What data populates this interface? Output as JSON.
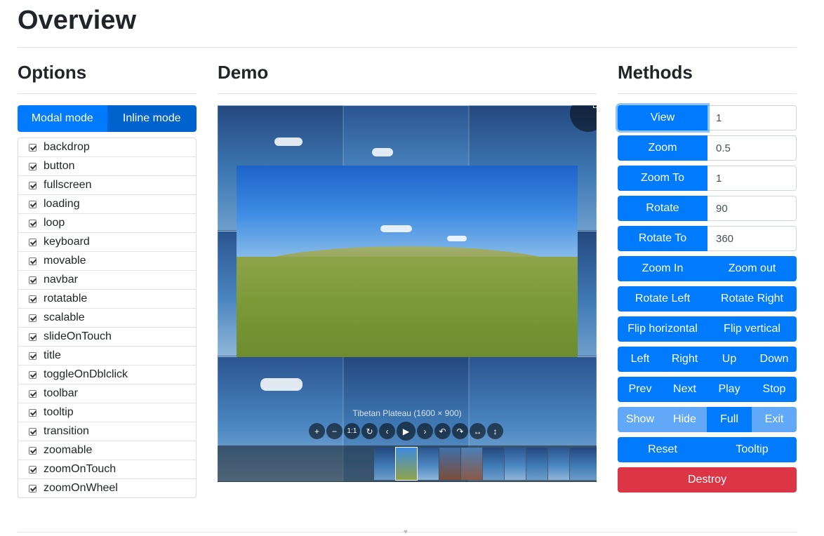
{
  "page": {
    "title": "Overview"
  },
  "columns": {
    "options": "Options",
    "demo": "Demo",
    "methods": "Methods"
  },
  "modes": {
    "modal": "Modal mode",
    "inline": "Inline mode"
  },
  "options": [
    "backdrop",
    "button",
    "fullscreen",
    "loading",
    "loop",
    "keyboard",
    "movable",
    "navbar",
    "rotatable",
    "scalable",
    "slideOnTouch",
    "title",
    "toggleOnDblclick",
    "toolbar",
    "tooltip",
    "transition",
    "zoomable",
    "zoomOnTouch",
    "zoomOnWheel"
  ],
  "viewer": {
    "caption": "Tibetan Plateau (1600 × 900)",
    "toolbar": [
      "+",
      "−",
      "1:1",
      "↻",
      "‹",
      "▶",
      "›",
      "↶",
      "↷",
      "↔",
      "↕"
    ]
  },
  "methods": {
    "view": {
      "label": "View",
      "value": "1"
    },
    "zoom": {
      "label": "Zoom",
      "value": "0.5"
    },
    "zoom_to": {
      "label": "Zoom To",
      "value": "1"
    },
    "rotate": {
      "label": "Rotate",
      "value": "90"
    },
    "rotate_to": {
      "label": "Rotate To",
      "value": "360"
    },
    "zoom_in": "Zoom In",
    "zoom_out": "Zoom out",
    "rotate_left": "Rotate Left",
    "rotate_right": "Rotate Right",
    "flip_horizontal": "Flip horizontal",
    "flip_vertical": "Flip vertical",
    "left": "Left",
    "right": "Right",
    "up": "Up",
    "down": "Down",
    "prev": "Prev",
    "next": "Next",
    "play": "Play",
    "stop": "Stop",
    "show": "Show",
    "hide": "Hide",
    "full": "Full",
    "exit": "Exit",
    "reset": "Reset",
    "tooltip": "Tooltip",
    "destroy": "Destroy"
  },
  "colors": {
    "primary": "#007bff",
    "primary_active": "#0062cc",
    "primary_light": "#61a9f8",
    "danger": "#dc3545"
  }
}
